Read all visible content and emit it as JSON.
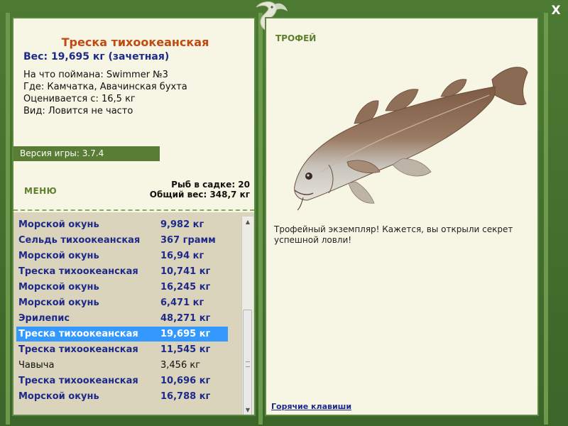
{
  "window": {
    "close_label": "X"
  },
  "fish": {
    "title": "Треска тихоокеанская",
    "weight": "Вес: 19,695 кг (зачетная)",
    "caught_with": "На что поймана: Swimmer №3",
    "location": "Где: Камчатка, Авачинская бухта",
    "rated_from": "Оценивается с: 16,5 кг",
    "kind": "Вид: Ловится не часто"
  },
  "version": "Версия игры: 3.7.4",
  "menu_label": "МЕНЮ",
  "stats": {
    "fish_in_cage": "Рыб в садке: 20",
    "total_weight": "Общий вес: 348,7 кг"
  },
  "catch_list": [
    {
      "name": "Морской окунь",
      "weight": "9,982 кг",
      "style": "bold"
    },
    {
      "name": "Сельдь тихоокеанская",
      "weight": "367 грамм",
      "style": "bold"
    },
    {
      "name": "Морской окунь",
      "weight": "16,94 кг",
      "style": "bold"
    },
    {
      "name": "Треска тихоокеанская",
      "weight": "10,741 кг",
      "style": "bold"
    },
    {
      "name": "Морской окунь",
      "weight": "16,245 кг",
      "style": "bold"
    },
    {
      "name": "Морской окунь",
      "weight": "6,471 кг",
      "style": "bold"
    },
    {
      "name": "Эрилепис",
      "weight": "48,271 кг",
      "style": "bold"
    },
    {
      "name": "Треска тихоокеанская",
      "weight": "19,695 кг",
      "style": "selected"
    },
    {
      "name": "Треска тихоокеанская",
      "weight": "11,545 кг",
      "style": "bold"
    },
    {
      "name": "Чавыча",
      "weight": "3,456 кг",
      "style": "plain"
    },
    {
      "name": "Треска тихоокеанская",
      "weight": "10,696 кг",
      "style": "bold"
    },
    {
      "name": "Морской окунь",
      "weight": "16,788 кг",
      "style": "bold"
    }
  ],
  "trophy": {
    "heading": "ТРОФЕЙ",
    "text": "Трофейный экземпляр! Кажется, вы открыли секрет успешной ловли!"
  },
  "hotkeys_link": "Горячие клавиши",
  "icons": {
    "logo": "fish-logo-icon",
    "close": "close-icon",
    "scroll_up": "chevron-up-icon",
    "scroll_down": "chevron-down-icon"
  },
  "colors": {
    "frame": "#3f6a2a",
    "panel": "#f7f5e3",
    "title": "#c04a12",
    "link": "#1e2a8a",
    "selected": "#3399ff"
  }
}
